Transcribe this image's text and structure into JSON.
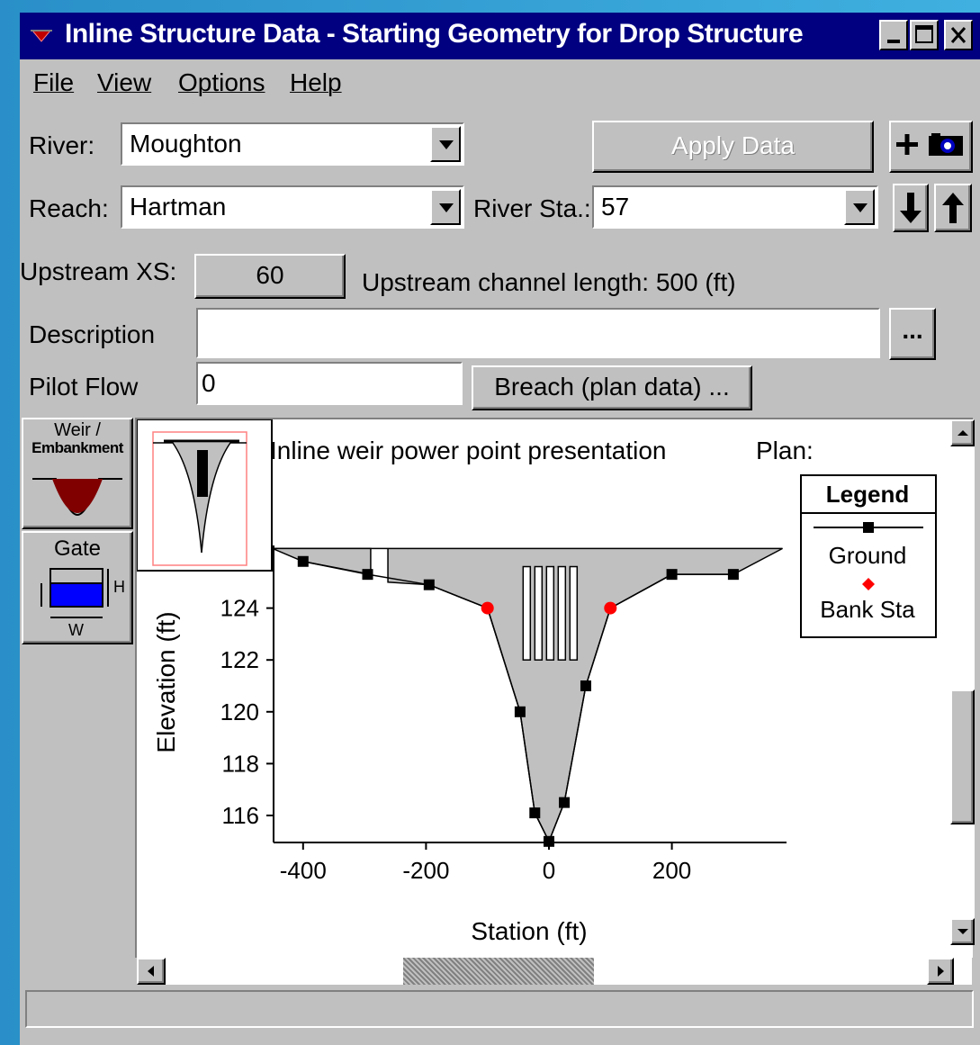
{
  "window": {
    "title": "Inline Structure Data - Starting Geometry for Drop Structure"
  },
  "menu": {
    "items": [
      "File",
      "View",
      "Options",
      "Help"
    ]
  },
  "form": {
    "river_label": "River:",
    "river_value": "Moughton",
    "reach_label": "Reach:",
    "reach_value": "Hartman",
    "river_sta_label": "River Sta.:",
    "river_sta_value": "57",
    "apply_button": "Apply Data",
    "upstream_xs_label": "Upstream XS:",
    "upstream_xs_value": "60",
    "upstream_length_text": "Upstream channel length: 500 (ft)",
    "description_label": "Description",
    "description_value": "",
    "browse_button": "...",
    "pilot_flow_label": "Pilot Flow",
    "pilot_flow_value": "0",
    "breach_button": "Breach (plan data) ..."
  },
  "side_buttons": {
    "weir_label_1": "Weir /",
    "weir_label_2": "Embankment",
    "gate_label": "Gate",
    "gate_h": "H",
    "gate_w": "W"
  },
  "icons": {
    "title": "hecras-window-icon",
    "minimize": "minimize-icon",
    "maximize": "maximize-icon",
    "close": "close-icon",
    "add": "plus-icon",
    "camera": "camera-icon",
    "down": "arrow-down-icon",
    "up": "arrow-up-icon"
  },
  "colors": {
    "title_bar": "#000080",
    "window_bg": "#c0c0c0",
    "ground_fill": "#c0c0c0",
    "bank_station": "#ff0000",
    "weir_icon": "#800000",
    "gate_icon": "#0000ff"
  },
  "chart_data": {
    "type": "line",
    "title": "Inline weir power point presentation",
    "plan_label": "Plan:",
    "xlabel": "Station (ft)",
    "ylabel": "Elevation (ft)",
    "xticks": [
      -400,
      -200,
      0,
      200
    ],
    "yticks": [
      116,
      118,
      120,
      122,
      124
    ],
    "legend": {
      "title": "Legend",
      "entries": [
        "Ground",
        "Bank Sta"
      ],
      "placement": "right"
    },
    "series": [
      {
        "name": "Ground",
        "x": [
          -400,
          -295,
          -195,
          -100,
          -47,
          -23,
          0,
          25,
          60,
          100,
          200,
          300
        ],
        "y": [
          125.8,
          125.3,
          124.9,
          124.0,
          120.0,
          116.1,
          115.0,
          116.5,
          121.0,
          124.0,
          125.3,
          125.3
        ]
      },
      {
        "name": "Bank Sta",
        "x": [
          -100,
          100
        ],
        "y": [
          124.0,
          124.0
        ]
      }
    ]
  }
}
